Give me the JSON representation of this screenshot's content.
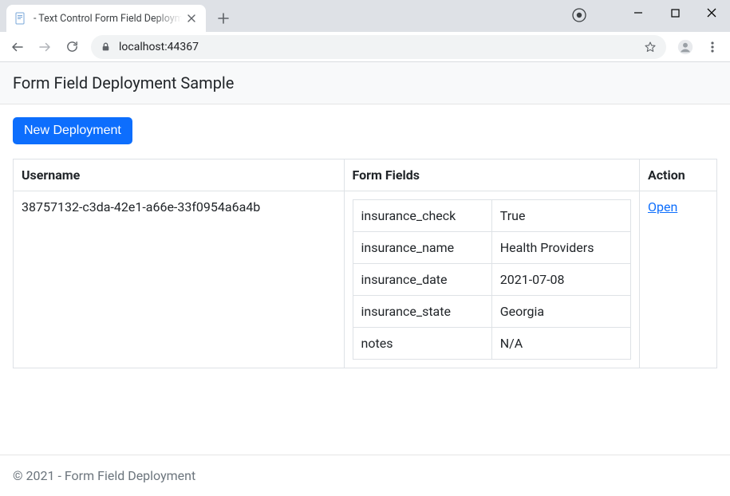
{
  "browser": {
    "tab_title": " - Text Control Form Field Deployment",
    "url": "localhost:44367"
  },
  "header": {
    "brand": "Form Field Deployment Sample"
  },
  "actions": {
    "new_deployment": "New Deployment"
  },
  "table": {
    "headers": {
      "username": "Username",
      "form_fields": "Form Fields",
      "action": "Action"
    },
    "rows": [
      {
        "username": "38757132-c3da-42e1-a66e-33f0954a6a4b",
        "fields": [
          {
            "key": "insurance_check",
            "value": "True"
          },
          {
            "key": "insurance_name",
            "value": "Health Providers"
          },
          {
            "key": "insurance_date",
            "value": "2021-07-08"
          },
          {
            "key": "insurance_state",
            "value": "Georgia"
          },
          {
            "key": "notes",
            "value": "N/A"
          }
        ],
        "action_label": "Open"
      }
    ]
  },
  "footer": {
    "text": "© 2021 - Form Field Deployment"
  }
}
